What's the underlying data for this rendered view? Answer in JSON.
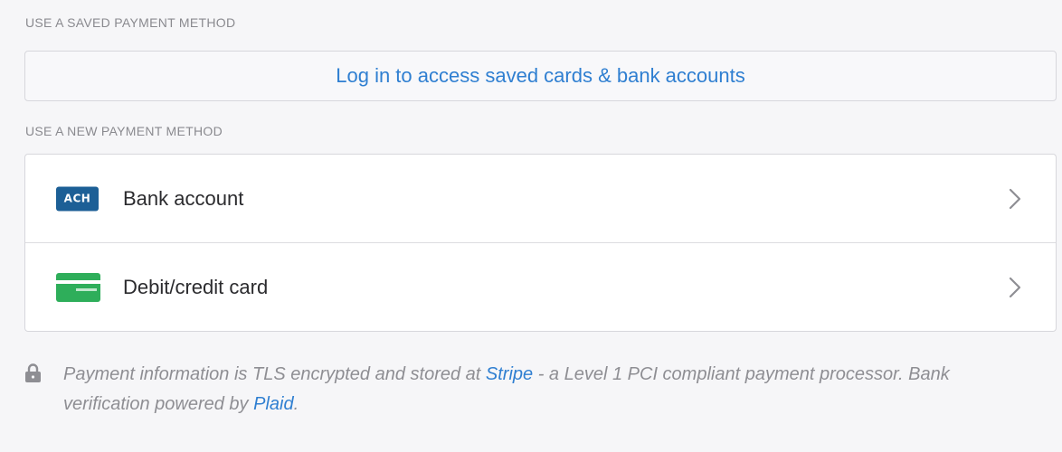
{
  "saved_section": {
    "label": "USE A SAVED PAYMENT METHOD",
    "login_button": "Log in to access saved cards & bank accounts"
  },
  "new_section": {
    "label": "USE A NEW PAYMENT METHOD",
    "methods": [
      {
        "icon": "ach-icon",
        "icon_text": "ACH",
        "label": "Bank account",
        "icon_color": "#1c5f96"
      },
      {
        "icon": "credit-card-icon",
        "label": "Debit/credit card",
        "icon_color": "#2eae5a"
      }
    ]
  },
  "security_note": {
    "icon": "lock-icon",
    "text_before_stripe": "Payment information is TLS encrypted and stored at ",
    "stripe_link": "Stripe",
    "text_middle": " - a Level 1 PCI compliant payment processor. Bank verification powered by ",
    "plaid_link": "Plaid",
    "text_end": "."
  },
  "colors": {
    "background": "#f6f6f8",
    "link": "#2f7fd1",
    "muted_text": "#8a8a8f",
    "border": "#d7d7dc"
  }
}
